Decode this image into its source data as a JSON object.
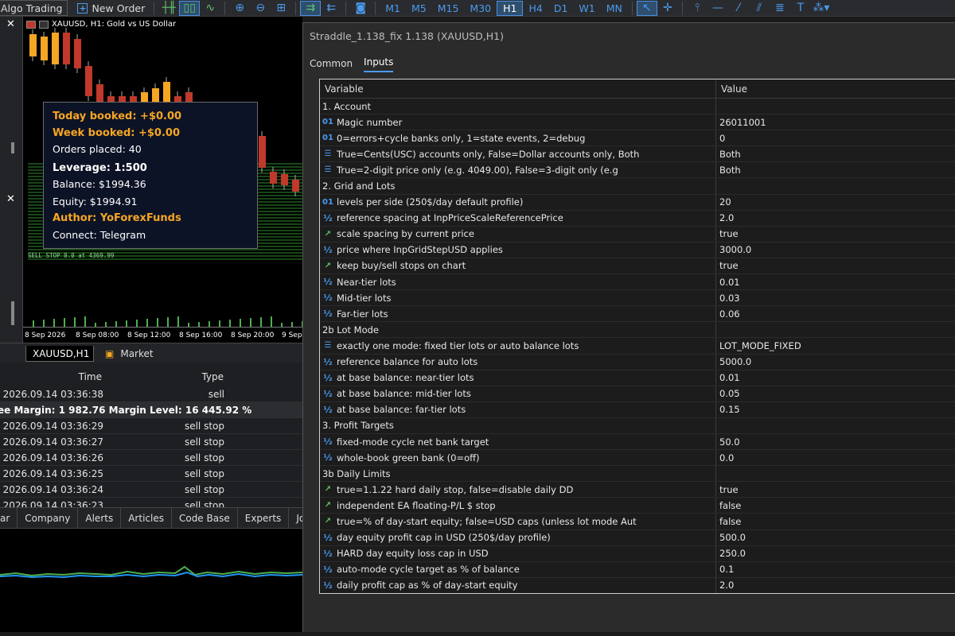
{
  "toolbar": {
    "algo_trading": "Algo Trading",
    "new_order": "New Order",
    "timeframes": [
      "M1",
      "M5",
      "M15",
      "M30",
      "H1",
      "H4",
      "D1",
      "W1",
      "MN"
    ],
    "active_timeframe": "H1"
  },
  "chart": {
    "symbol_title": "XAUUSD, H1:  Gold vs US Dollar",
    "info": {
      "today_booked": "Today booked: +$0.00",
      "week_booked": "Week booked: +$0.00",
      "orders_placed": "Orders placed: 40",
      "leverage": "Leverage: 1:500",
      "balance": "Balance: $1994.36",
      "equity": "Equity: $1994.91",
      "author": "Author: YoForexFunds",
      "connect": "Connect: Telegram"
    },
    "pending_label": "SELL STOP 0.0 at 4369.99",
    "x_labels": [
      "8 Sep 2026",
      "8 Sep 08:00",
      "8 Sep 12:00",
      "8 Sep 16:00",
      "8 Sep 20:00",
      "9 Sep"
    ]
  },
  "chart_tabs": {
    "symbol": "XAUUSD,H1",
    "market": "Market"
  },
  "terminal": {
    "headers": {
      "time": "Time",
      "type": "Type"
    },
    "margin_line": "ee Margin: 1 982.76  Margin Level: 16 445.92 %",
    "rows": [
      {
        "time": "2026.09.14 03:36:38",
        "type": "sell"
      },
      {
        "time": "2026.09.14 03:36:29",
        "type": "sell stop"
      },
      {
        "time": "2026.09.14 03:36:27",
        "type": "sell stop"
      },
      {
        "time": "2026.09.14 03:36:26",
        "type": "sell stop"
      },
      {
        "time": "2026.09.14 03:36:25",
        "type": "sell stop"
      },
      {
        "time": "2026.09.14 03:36:24",
        "type": "sell stop"
      },
      {
        "time": "2026.09.14 03:36:23",
        "type": "sell stop"
      }
    ],
    "tabs": [
      "ar",
      "Company",
      "Alerts",
      "Articles",
      "Code Base",
      "Experts",
      "Journal"
    ]
  },
  "dialog": {
    "title": "Straddle_1.138_fix 1.138 (XAUUSD,H1)",
    "tabs": [
      "Common",
      "Inputs"
    ],
    "active_tab": "Inputs",
    "headers": {
      "variable": "Variable",
      "value": "Value"
    },
    "rows": [
      {
        "section": true,
        "variable": "1. Account",
        "value": ""
      },
      {
        "icon": "01",
        "variable": "Magic number",
        "value": "26011001"
      },
      {
        "icon": "01",
        "variable": "0=errors+cycle banks only, 1=state events, 2=debug",
        "value": "0"
      },
      {
        "icon": "list",
        "variable": "True=Cents(USC) accounts only, False=Dollar accounts only, Both",
        "value": "Both"
      },
      {
        "icon": "list",
        "variable": "True=2-digit price only (e.g. 4049.00), False=3-digit only (e.g",
        "value": "Both"
      },
      {
        "section": true,
        "variable": "2. Grid and Lots",
        "value": ""
      },
      {
        "icon": "01",
        "variable": "levels per side (250$/day default profile)",
        "value": "20"
      },
      {
        "icon": "half",
        "variable": "reference spacing at InpPriceScaleReferencePrice",
        "value": "2.0"
      },
      {
        "icon": "bool",
        "variable": "scale spacing by current price",
        "value": "true"
      },
      {
        "icon": "half",
        "variable": "price where InpGridStepUSD applies",
        "value": "3000.0"
      },
      {
        "icon": "bool",
        "variable": "keep buy/sell stops on chart",
        "value": "true"
      },
      {
        "icon": "half",
        "variable": "Near-tier lots",
        "value": "0.01"
      },
      {
        "icon": "half",
        "variable": "Mid-tier lots",
        "value": "0.03"
      },
      {
        "icon": "half",
        "variable": "Far-tier lots",
        "value": "0.06"
      },
      {
        "section": true,
        "variable": "2b Lot Mode",
        "value": ""
      },
      {
        "icon": "list",
        "variable": "exactly one mode: fixed tier lots or auto balance lots",
        "value": "LOT_MODE_FIXED"
      },
      {
        "icon": "half",
        "variable": "reference balance for auto lots",
        "value": "5000.0"
      },
      {
        "icon": "half",
        "variable": "at base balance: near-tier lots",
        "value": "0.01"
      },
      {
        "icon": "half",
        "variable": "at base balance: mid-tier lots",
        "value": "0.05"
      },
      {
        "icon": "half",
        "variable": "at base balance: far-tier lots",
        "value": "0.15"
      },
      {
        "section": true,
        "variable": "3. Profit Targets",
        "value": ""
      },
      {
        "icon": "half",
        "variable": "fixed-mode cycle net bank target",
        "value": "50.0"
      },
      {
        "icon": "half",
        "variable": "whole-book green bank (0=off)",
        "value": "0.0"
      },
      {
        "section": true,
        "variable": "3b Daily Limits",
        "value": ""
      },
      {
        "icon": "bool",
        "variable": "true=1.1.22 hard daily stop, false=disable daily DD",
        "value": "true"
      },
      {
        "icon": "bool",
        "variable": "independent EA floating-P/L $ stop",
        "value": "false"
      },
      {
        "icon": "bool",
        "variable": "true=% of day-start equity; false=USD caps (unless lot mode Aut",
        "value": "false"
      },
      {
        "icon": "half",
        "variable": "day equity profit cap in USD (250$/day profile)",
        "value": "500.0"
      },
      {
        "icon": "half",
        "variable": "HARD day equity loss cap in USD",
        "value": "250.0"
      },
      {
        "icon": "half",
        "variable": "auto-mode cycle target as % of balance",
        "value": "0.1"
      },
      {
        "icon": "half",
        "variable": "daily profit cap as % of day-start equity",
        "value": "2.0"
      }
    ]
  }
}
